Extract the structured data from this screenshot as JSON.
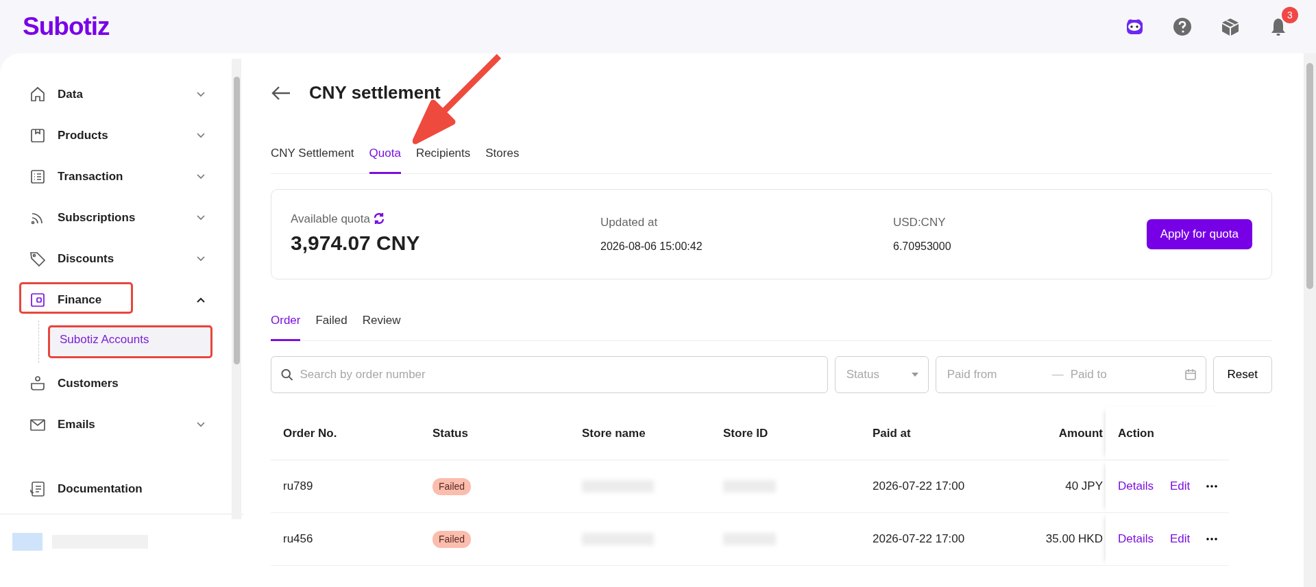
{
  "header": {
    "logo": "Subotiz",
    "notification_count": "3"
  },
  "sidebar": {
    "items": [
      {
        "label": "Data",
        "expanded": false
      },
      {
        "label": "Products",
        "expanded": false
      },
      {
        "label": "Transaction",
        "expanded": false
      },
      {
        "label": "Subscriptions",
        "expanded": false
      },
      {
        "label": "Discounts",
        "expanded": false
      },
      {
        "label": "Finance",
        "expanded": true,
        "selected": true,
        "children": [
          {
            "label": "Subotiz Accounts",
            "selected": true
          }
        ]
      },
      {
        "label": "Customers"
      },
      {
        "label": "Emails",
        "expanded": false
      }
    ],
    "footer_link": "Documentation"
  },
  "page": {
    "title": "CNY settlement",
    "tabs": [
      {
        "label": "CNY Settlement",
        "selected": false
      },
      {
        "label": "Quota",
        "selected": true
      },
      {
        "label": "Recipients",
        "selected": false
      },
      {
        "label": "Stores",
        "selected": false
      }
    ],
    "quota": {
      "label": "Available quota",
      "value": "3,974.07 CNY",
      "updated_label": "Updated at",
      "updated_value": "2026-08-06 15:00:42",
      "rate_label": "USD:CNY",
      "rate_value": "6.70953000",
      "button": "Apply for quota"
    },
    "subtabs": [
      {
        "label": "Order",
        "selected": true
      },
      {
        "label": "Failed",
        "selected": false
      },
      {
        "label": "Review",
        "selected": false
      }
    ],
    "filters": {
      "search_placeholder": "Search by order number",
      "status_placeholder": "Status",
      "from_placeholder": "Paid from",
      "separator": "—",
      "to_placeholder": "Paid to",
      "reset": "Reset"
    },
    "table": {
      "columns": [
        "Order No.",
        "Status",
        "Store name",
        "Store ID",
        "Paid at",
        "Amount",
        "Action"
      ],
      "rows": [
        {
          "order": "ru789",
          "status": "Failed",
          "color": "#fbbdae",
          "paid_at": "2026-07-22 17:00",
          "amount": "40 JPY",
          "actions": [
            "Details",
            "Edit"
          ]
        },
        {
          "order": "ru456",
          "status": "Failed",
          "color": "#fbbdae",
          "paid_at": "2026-07-22 17:00",
          "amount": "35.00 HKD",
          "actions": [
            "Details",
            "Edit"
          ]
        }
      ]
    }
  }
}
